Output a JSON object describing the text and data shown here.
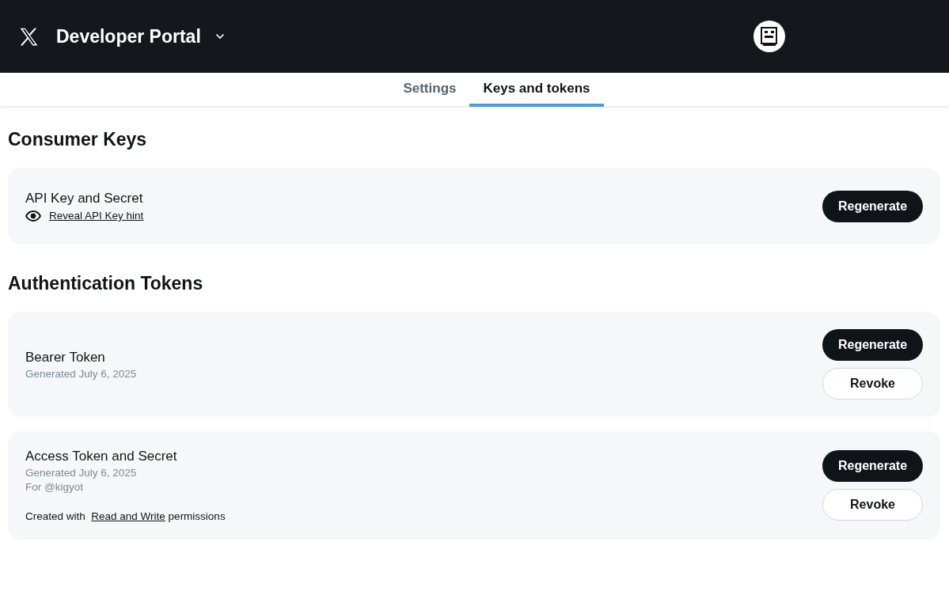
{
  "header": {
    "title": "Developer Portal"
  },
  "tabs": [
    {
      "label": "Settings",
      "selected": false
    },
    {
      "label": "Keys and tokens",
      "selected": true
    }
  ],
  "sections": [
    {
      "heading": "Consumer Keys",
      "cards": [
        {
          "title": "API Key and Secret",
          "reveal_link": "Reveal API Key hint",
          "buttons": [
            {
              "label": "Regenerate",
              "kind": "primary"
            }
          ]
        }
      ]
    },
    {
      "heading": "Authentication Tokens",
      "cards": [
        {
          "title": "Bearer Token",
          "meta": [
            "Generated July 6, 2025"
          ],
          "buttons": [
            {
              "label": "Regenerate",
              "kind": "primary"
            },
            {
              "label": "Revoke",
              "kind": "outline"
            }
          ]
        },
        {
          "title": "Access Token and Secret",
          "meta": [
            "Generated July 6, 2025",
            "For @kigyot"
          ],
          "permissions": {
            "prefix": "Created with",
            "link": "Read and Write",
            "suffix": "permissions"
          },
          "buttons": [
            {
              "label": "Regenerate",
              "kind": "primary"
            },
            {
              "label": "Revoke",
              "kind": "outline"
            }
          ]
        }
      ]
    }
  ]
}
